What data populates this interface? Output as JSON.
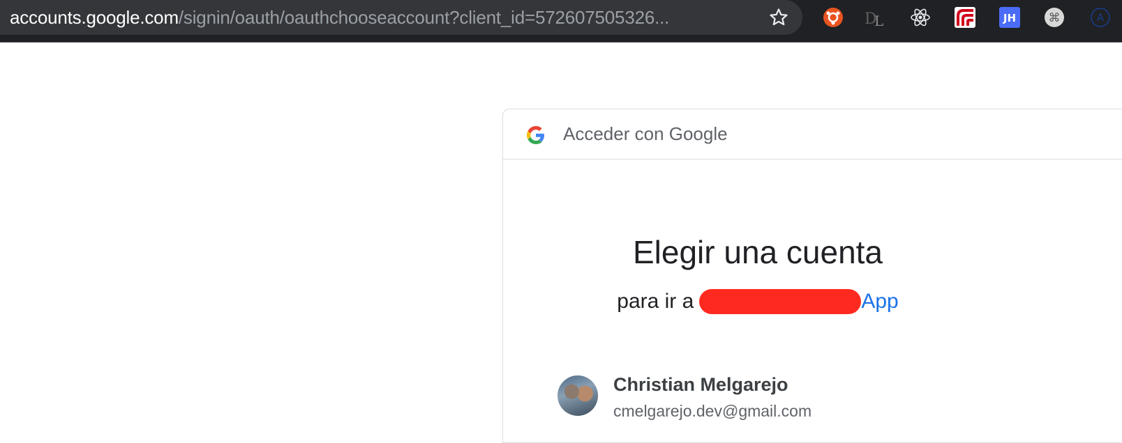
{
  "browser": {
    "url_host": "accounts.google.com",
    "url_path": "/signin/oauth/oauthchooseaccount?client_id=572607505326...",
    "extensions": [
      {
        "name": "ubuntu-extension-icon"
      },
      {
        "name": "dl-extension-icon"
      },
      {
        "name": "react-devtools-icon"
      },
      {
        "name": "redux-extension-icon"
      },
      {
        "name": "jh-extension-icon",
        "label": "JH"
      },
      {
        "name": "command-extension-icon",
        "label": "⌘"
      },
      {
        "name": "a-extension-icon",
        "label": "A"
      }
    ]
  },
  "signin": {
    "header_title": "Acceder con Google",
    "title": "Elegir una cuenta",
    "subtitle_prefix": "para ir a",
    "app_suffix": "App",
    "accounts": [
      {
        "name": "Christian Melgarejo",
        "email": "cmelgarejo.dev@gmail.com"
      }
    ]
  }
}
